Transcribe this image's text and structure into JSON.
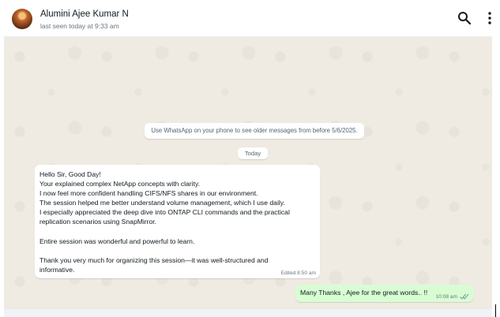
{
  "header": {
    "contact_name": "Alumini Ajee Kumar N",
    "last_seen": "last seen today at 9:33 am",
    "icons": [
      "search-icon",
      "more-options-icon"
    ]
  },
  "chat": {
    "info_note": "Use WhatsApp on your phone to see older messages from before 5/6/2025.",
    "day_label": "Today",
    "incoming": {
      "lines": [
        "Hello Sir, Good Day!",
        "Your explained complex NetApp concepts with clarity.",
        "I now feel more confident handling CIFS/NFS shares in our environment.",
        "The session helped me better understand volume management, which I use daily.",
        "I especially appreciated the deep dive into ONTAP CLI commands and the practical",
        "replication scenarios using SnapMirror.",
        "",
        "Entire session was wonderful and powerful to learn.",
        "",
        "Thank you very much for organizing this session—it was well-structured and",
        "informative."
      ],
      "meta": "Edited 8:50 am"
    },
    "outgoing": {
      "text": "Many Thanks , Ajee for the great words.. !!",
      "time": "10:08 am",
      "status_icon": "double-check-icon"
    }
  },
  "colors": {
    "chat_background": "#efeae2",
    "incoming_bubble": "#ffffff",
    "outgoing_bubble": "#d9fdd3",
    "read_tick": "#53bdeb"
  }
}
